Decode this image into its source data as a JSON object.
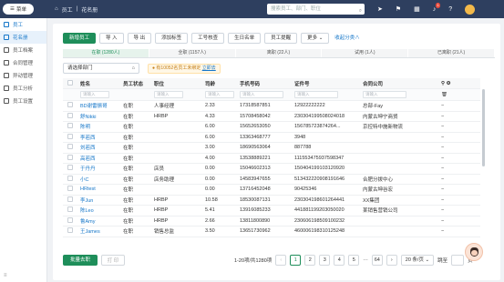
{
  "topbar": {
    "menu_label": "菜单",
    "breadcrumb": [
      "员工",
      "花名册"
    ],
    "search_placeholder": "搜索员工、部门、职位",
    "badge_count": "1"
  },
  "sidebar": {
    "items": [
      {
        "label": "员工",
        "state": "active"
      },
      {
        "label": "花名册",
        "state": "selected"
      },
      {
        "label": "员工档案",
        "state": ""
      },
      {
        "label": "合同管理",
        "state": ""
      },
      {
        "label": "异动管理",
        "state": ""
      },
      {
        "label": "员工分析",
        "state": ""
      },
      {
        "label": "员工设置",
        "state": ""
      }
    ]
  },
  "toolbar": {
    "buttons": [
      "新增员工",
      "导 入",
      "导 出",
      "添加标签",
      "工号核查",
      "生日名单",
      "员工提醒",
      "更多"
    ],
    "link": "收起分类∧"
  },
  "status_tabs": [
    "在职 (1280人)",
    "全职 (1157人)",
    "离职 (22人)",
    "试用 (1人)",
    "已离职 (21人)"
  ],
  "filter": {
    "label": "请选择部门"
  },
  "notice": {
    "text": "有10052名员工未绑定",
    "link": "立即去"
  },
  "table": {
    "headers": [
      "姓名",
      "员工状态",
      "职位",
      "司龄",
      "手机号码",
      "证件号",
      "合同公司",
      ""
    ],
    "filters": [
      "请输入",
      "请输入",
      "请输入",
      "请输入",
      "请输入",
      "请输入",
      "请输入"
    ],
    "op_dash": "−",
    "rows": [
      [
        "BD谢雷振哥",
        "在职",
        "人事经理",
        "2.33",
        "17318587851",
        "12922222222",
        "总部-Fay"
      ],
      [
        "舒Nikki",
        "在职",
        "HRBP",
        "4.33",
        "15708458042",
        "230304199508024018",
        "内蒙古坤宁商贸"
      ],
      [
        "陈明",
        "在职",
        "",
        "6.00",
        "15652653050",
        "156785723874264...",
        "京控特中施新物流"
      ],
      [
        "李若西",
        "在职",
        "",
        "6.00",
        "13363468777",
        "3948",
        ""
      ],
      [
        "刘若西",
        "在职",
        "",
        "3.00",
        "18690563064",
        "887788",
        ""
      ],
      [
        "高若西",
        "在职",
        "",
        "4.00",
        "13538889221",
        "111553475937598347",
        ""
      ],
      [
        "于丹丹",
        "在职",
        "店员",
        "0.00",
        "15046602313",
        "150404199103120920",
        ""
      ],
      [
        "小C",
        "在职",
        "店务助理",
        "0.00",
        "14583947655",
        "513432220908191646",
        "合肥分拨中心"
      ],
      [
        "HRtest",
        "在职",
        "",
        "0.00",
        "13716452048",
        "90425346",
        "内蒙古坤谷宏"
      ],
      [
        "李Jun",
        "在职",
        "HRBP",
        "10.58",
        "18530087131",
        "230304198601264441",
        "XX集团"
      ],
      [
        "陈Leo",
        "在职",
        "HRBP",
        "5.41",
        "13916085233",
        "441881199203050020",
        "某销售营销公司"
      ],
      [
        "鲁Amy",
        "在职",
        "HRBP",
        "2.66",
        "13811800890",
        "230606198509100232",
        ""
      ],
      [
        "王James",
        "在职",
        "销售总监",
        "3.50",
        "13651730962",
        "460006198310125248",
        ""
      ]
    ]
  },
  "footer": {
    "batch_button": "批量去职",
    "print_button": "打 印",
    "summary": "1-20项/共1280项",
    "pages": [
      "1",
      "2",
      "3",
      "4",
      "5",
      "···",
      "64"
    ],
    "current_page": "1",
    "page_size": "20 条/页",
    "jump_label": "跳至",
    "page_suffix": "页"
  }
}
